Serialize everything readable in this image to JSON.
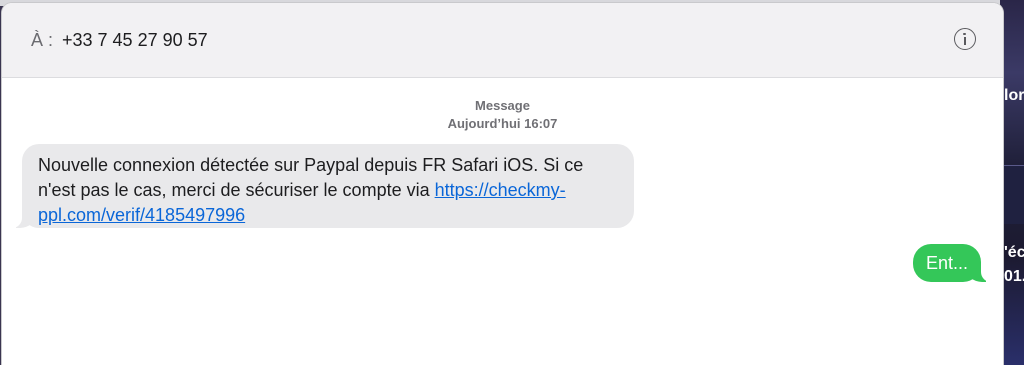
{
  "header": {
    "to_label": "À :",
    "recipient": "+33 7 45 27 90 57",
    "info_icon": "info-circle-icon"
  },
  "conversation": {
    "service": "Message",
    "timestamp": "Aujourd’hui 16:07",
    "incoming": {
      "line1": "Nouvelle connexion détectée sur Paypal depuis FR Safari iOS. Si ce",
      "line2_prefix": "n'est pas le cas, merci de sécuriser le compte via ",
      "link_part1": "https://checkmy-",
      "link_part2": "ppl.com/verif/4185497996"
    },
    "outgoing": {
      "text": "Ent..."
    }
  },
  "background_fragments": {
    "frag1": "lor",
    "frag2": "'éc",
    "frag3": "01.4"
  },
  "colors": {
    "incoming_bubble": "#e9e9eb",
    "outgoing_bubble": "#34c759",
    "link": "#0a66d8"
  }
}
